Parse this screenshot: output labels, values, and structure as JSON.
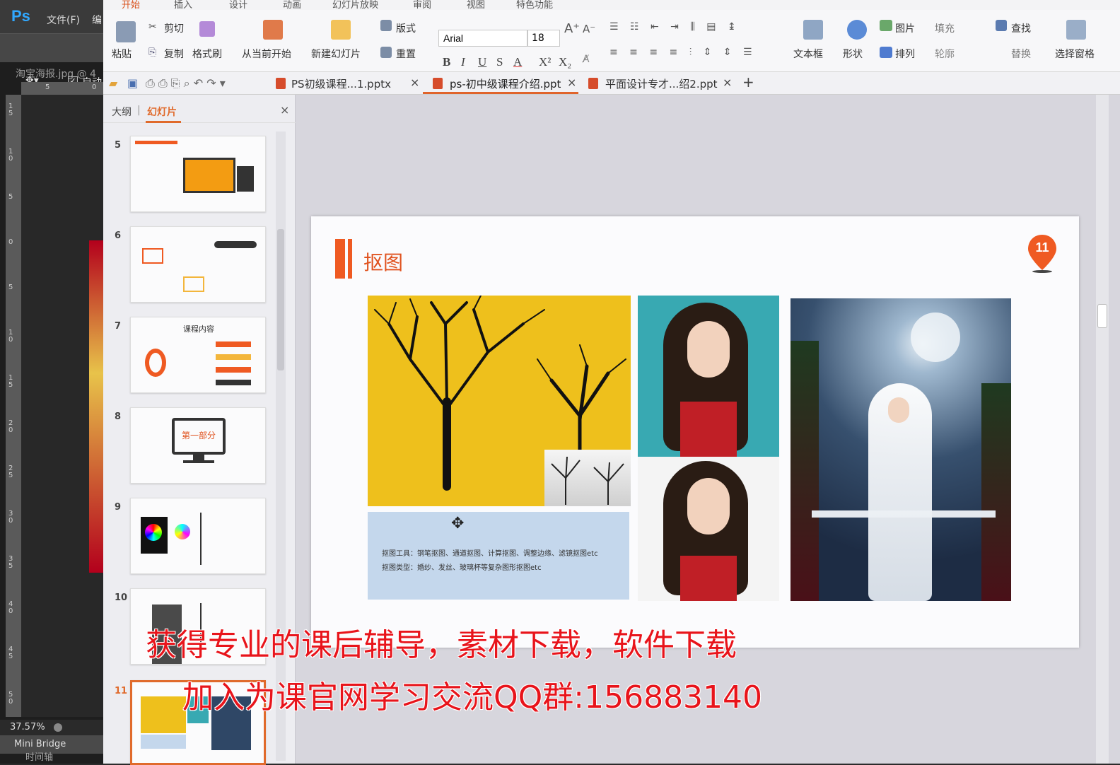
{
  "photoshop": {
    "menu_file": "文件(F)",
    "menu_partial": "编",
    "auto_label": "自动",
    "doc_tab": "淘宝海报.jpg @ 4",
    "zoom": "37.57%",
    "mini_bridge": "Mini Bridge",
    "timeline": "时间轴",
    "ruler_top": [
      "5",
      "0"
    ],
    "ruler_left": [
      "1\n5",
      "1\n0",
      "5",
      "0",
      "5",
      "1\n0",
      "1\n5",
      "2\n0",
      "2\n5",
      "3\n0",
      "3\n5",
      "4\n0",
      "4\n5",
      "5\n0"
    ]
  },
  "ribbon": {
    "tabs": [
      "开始",
      "插入",
      "设计",
      "动画",
      "幻灯片放映",
      "审阅",
      "视图",
      "特色功能"
    ],
    "paste": "粘贴",
    "cut": "剪切",
    "copy": "复制",
    "format_painter": "格式刷",
    "from_current": "从当前开始",
    "new_slide": "新建幻灯片",
    "layout": "版式",
    "reset": "重置",
    "font": "Arial",
    "font_size": "18",
    "bold": "B",
    "italic": "I",
    "underline": "U",
    "strike": "S",
    "font_color": "A",
    "superscript": "X²",
    "subscript": "X₂",
    "textbox": "文本框",
    "shape": "形状",
    "picture": "图片",
    "arrange": "排列",
    "fill": "填充",
    "outline": "轮廓",
    "find": "查找",
    "replace": "替换",
    "select_pane": "选择窗格"
  },
  "doc_tabs": [
    {
      "label": "PS初级课程...1.pptx"
    },
    {
      "label": "ps-初中级课程介绍.ppt"
    },
    {
      "label": "平面设计专才...绍2.ppt"
    }
  ],
  "panel": {
    "outline_tab": "大纲",
    "slides_tab": "幻灯片",
    "thumb_numbers": [
      "5",
      "6",
      "7",
      "8",
      "9",
      "10",
      "11"
    ],
    "thumb7_title": "课程内容",
    "thumb8_title": "第一部分"
  },
  "slide": {
    "title": "抠图",
    "page_number": "11",
    "info_line1": "抠图工具：钢笔抠图、通道抠图、计算抠图、调整边缘、滤镜抠图etc",
    "info_line2": "抠图类型：婚纱、发丝、玻璃杯等复杂图形抠图etc"
  },
  "overlay": {
    "line1": "获得专业的课后辅导，素材下载，软件下载",
    "line2": "加入为课官网学习交流QQ群:156883140"
  },
  "colors": {
    "accent": "#e0521e",
    "overlay_text": "#e8141b"
  }
}
